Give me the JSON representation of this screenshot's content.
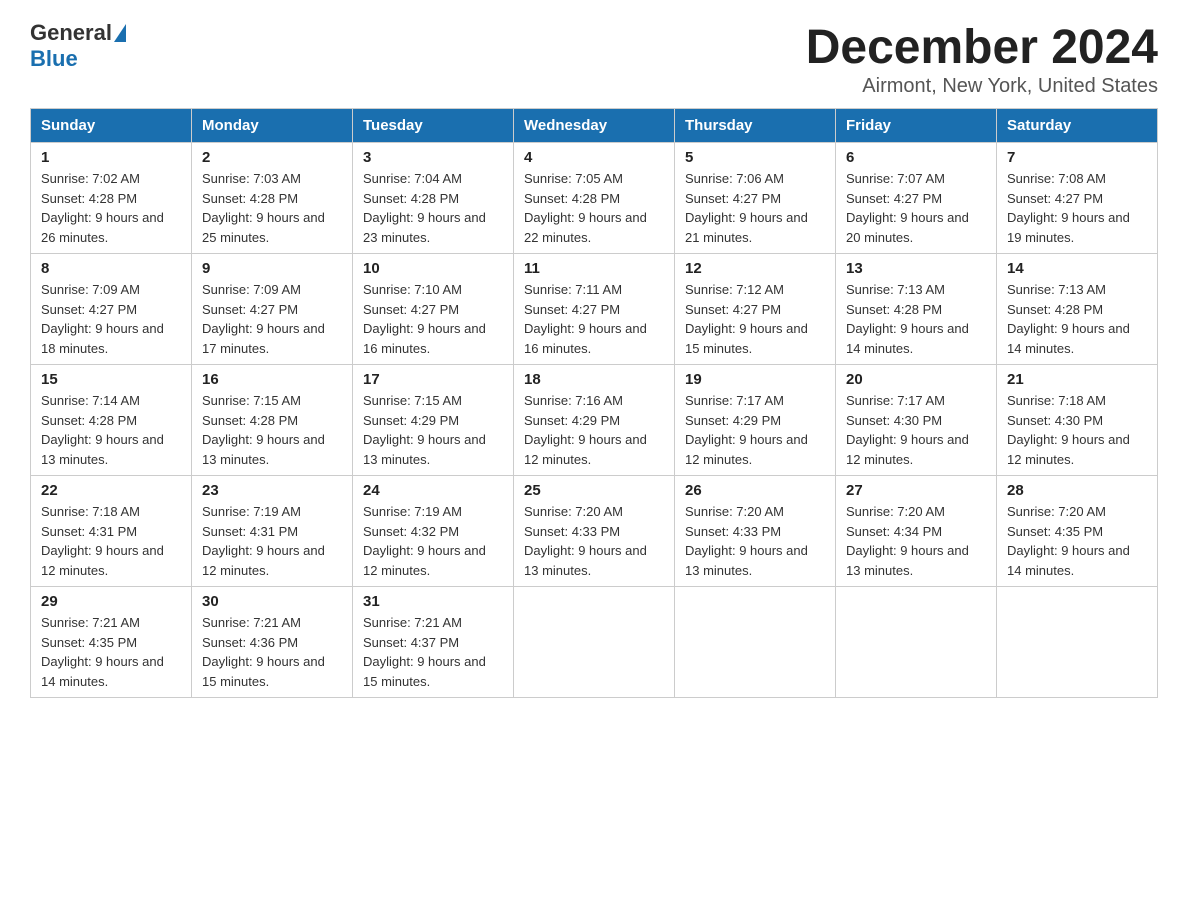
{
  "logo": {
    "text_general": "General",
    "text_blue": "Blue"
  },
  "title": "December 2024",
  "location": "Airmont, New York, United States",
  "days_of_week": [
    "Sunday",
    "Monday",
    "Tuesday",
    "Wednesday",
    "Thursday",
    "Friday",
    "Saturday"
  ],
  "weeks": [
    [
      {
        "date": "1",
        "sunrise": "7:02 AM",
        "sunset": "4:28 PM",
        "daylight": "9 hours and 26 minutes."
      },
      {
        "date": "2",
        "sunrise": "7:03 AM",
        "sunset": "4:28 PM",
        "daylight": "9 hours and 25 minutes."
      },
      {
        "date": "3",
        "sunrise": "7:04 AM",
        "sunset": "4:28 PM",
        "daylight": "9 hours and 23 minutes."
      },
      {
        "date": "4",
        "sunrise": "7:05 AM",
        "sunset": "4:28 PM",
        "daylight": "9 hours and 22 minutes."
      },
      {
        "date": "5",
        "sunrise": "7:06 AM",
        "sunset": "4:27 PM",
        "daylight": "9 hours and 21 minutes."
      },
      {
        "date": "6",
        "sunrise": "7:07 AM",
        "sunset": "4:27 PM",
        "daylight": "9 hours and 20 minutes."
      },
      {
        "date": "7",
        "sunrise": "7:08 AM",
        "sunset": "4:27 PM",
        "daylight": "9 hours and 19 minutes."
      }
    ],
    [
      {
        "date": "8",
        "sunrise": "7:09 AM",
        "sunset": "4:27 PM",
        "daylight": "9 hours and 18 minutes."
      },
      {
        "date": "9",
        "sunrise": "7:09 AM",
        "sunset": "4:27 PM",
        "daylight": "9 hours and 17 minutes."
      },
      {
        "date": "10",
        "sunrise": "7:10 AM",
        "sunset": "4:27 PM",
        "daylight": "9 hours and 16 minutes."
      },
      {
        "date": "11",
        "sunrise": "7:11 AM",
        "sunset": "4:27 PM",
        "daylight": "9 hours and 16 minutes."
      },
      {
        "date": "12",
        "sunrise": "7:12 AM",
        "sunset": "4:27 PM",
        "daylight": "9 hours and 15 minutes."
      },
      {
        "date": "13",
        "sunrise": "7:13 AM",
        "sunset": "4:28 PM",
        "daylight": "9 hours and 14 minutes."
      },
      {
        "date": "14",
        "sunrise": "7:13 AM",
        "sunset": "4:28 PM",
        "daylight": "9 hours and 14 minutes."
      }
    ],
    [
      {
        "date": "15",
        "sunrise": "7:14 AM",
        "sunset": "4:28 PM",
        "daylight": "9 hours and 13 minutes."
      },
      {
        "date": "16",
        "sunrise": "7:15 AM",
        "sunset": "4:28 PM",
        "daylight": "9 hours and 13 minutes."
      },
      {
        "date": "17",
        "sunrise": "7:15 AM",
        "sunset": "4:29 PM",
        "daylight": "9 hours and 13 minutes."
      },
      {
        "date": "18",
        "sunrise": "7:16 AM",
        "sunset": "4:29 PM",
        "daylight": "9 hours and 12 minutes."
      },
      {
        "date": "19",
        "sunrise": "7:17 AM",
        "sunset": "4:29 PM",
        "daylight": "9 hours and 12 minutes."
      },
      {
        "date": "20",
        "sunrise": "7:17 AM",
        "sunset": "4:30 PM",
        "daylight": "9 hours and 12 minutes."
      },
      {
        "date": "21",
        "sunrise": "7:18 AM",
        "sunset": "4:30 PM",
        "daylight": "9 hours and 12 minutes."
      }
    ],
    [
      {
        "date": "22",
        "sunrise": "7:18 AM",
        "sunset": "4:31 PM",
        "daylight": "9 hours and 12 minutes."
      },
      {
        "date": "23",
        "sunrise": "7:19 AM",
        "sunset": "4:31 PM",
        "daylight": "9 hours and 12 minutes."
      },
      {
        "date": "24",
        "sunrise": "7:19 AM",
        "sunset": "4:32 PM",
        "daylight": "9 hours and 12 minutes."
      },
      {
        "date": "25",
        "sunrise": "7:20 AM",
        "sunset": "4:33 PM",
        "daylight": "9 hours and 13 minutes."
      },
      {
        "date": "26",
        "sunrise": "7:20 AM",
        "sunset": "4:33 PM",
        "daylight": "9 hours and 13 minutes."
      },
      {
        "date": "27",
        "sunrise": "7:20 AM",
        "sunset": "4:34 PM",
        "daylight": "9 hours and 13 minutes."
      },
      {
        "date": "28",
        "sunrise": "7:20 AM",
        "sunset": "4:35 PM",
        "daylight": "9 hours and 14 minutes."
      }
    ],
    [
      {
        "date": "29",
        "sunrise": "7:21 AM",
        "sunset": "4:35 PM",
        "daylight": "9 hours and 14 minutes."
      },
      {
        "date": "30",
        "sunrise": "7:21 AM",
        "sunset": "4:36 PM",
        "daylight": "9 hours and 15 minutes."
      },
      {
        "date": "31",
        "sunrise": "7:21 AM",
        "sunset": "4:37 PM",
        "daylight": "9 hours and 15 minutes."
      },
      null,
      null,
      null,
      null
    ]
  ]
}
